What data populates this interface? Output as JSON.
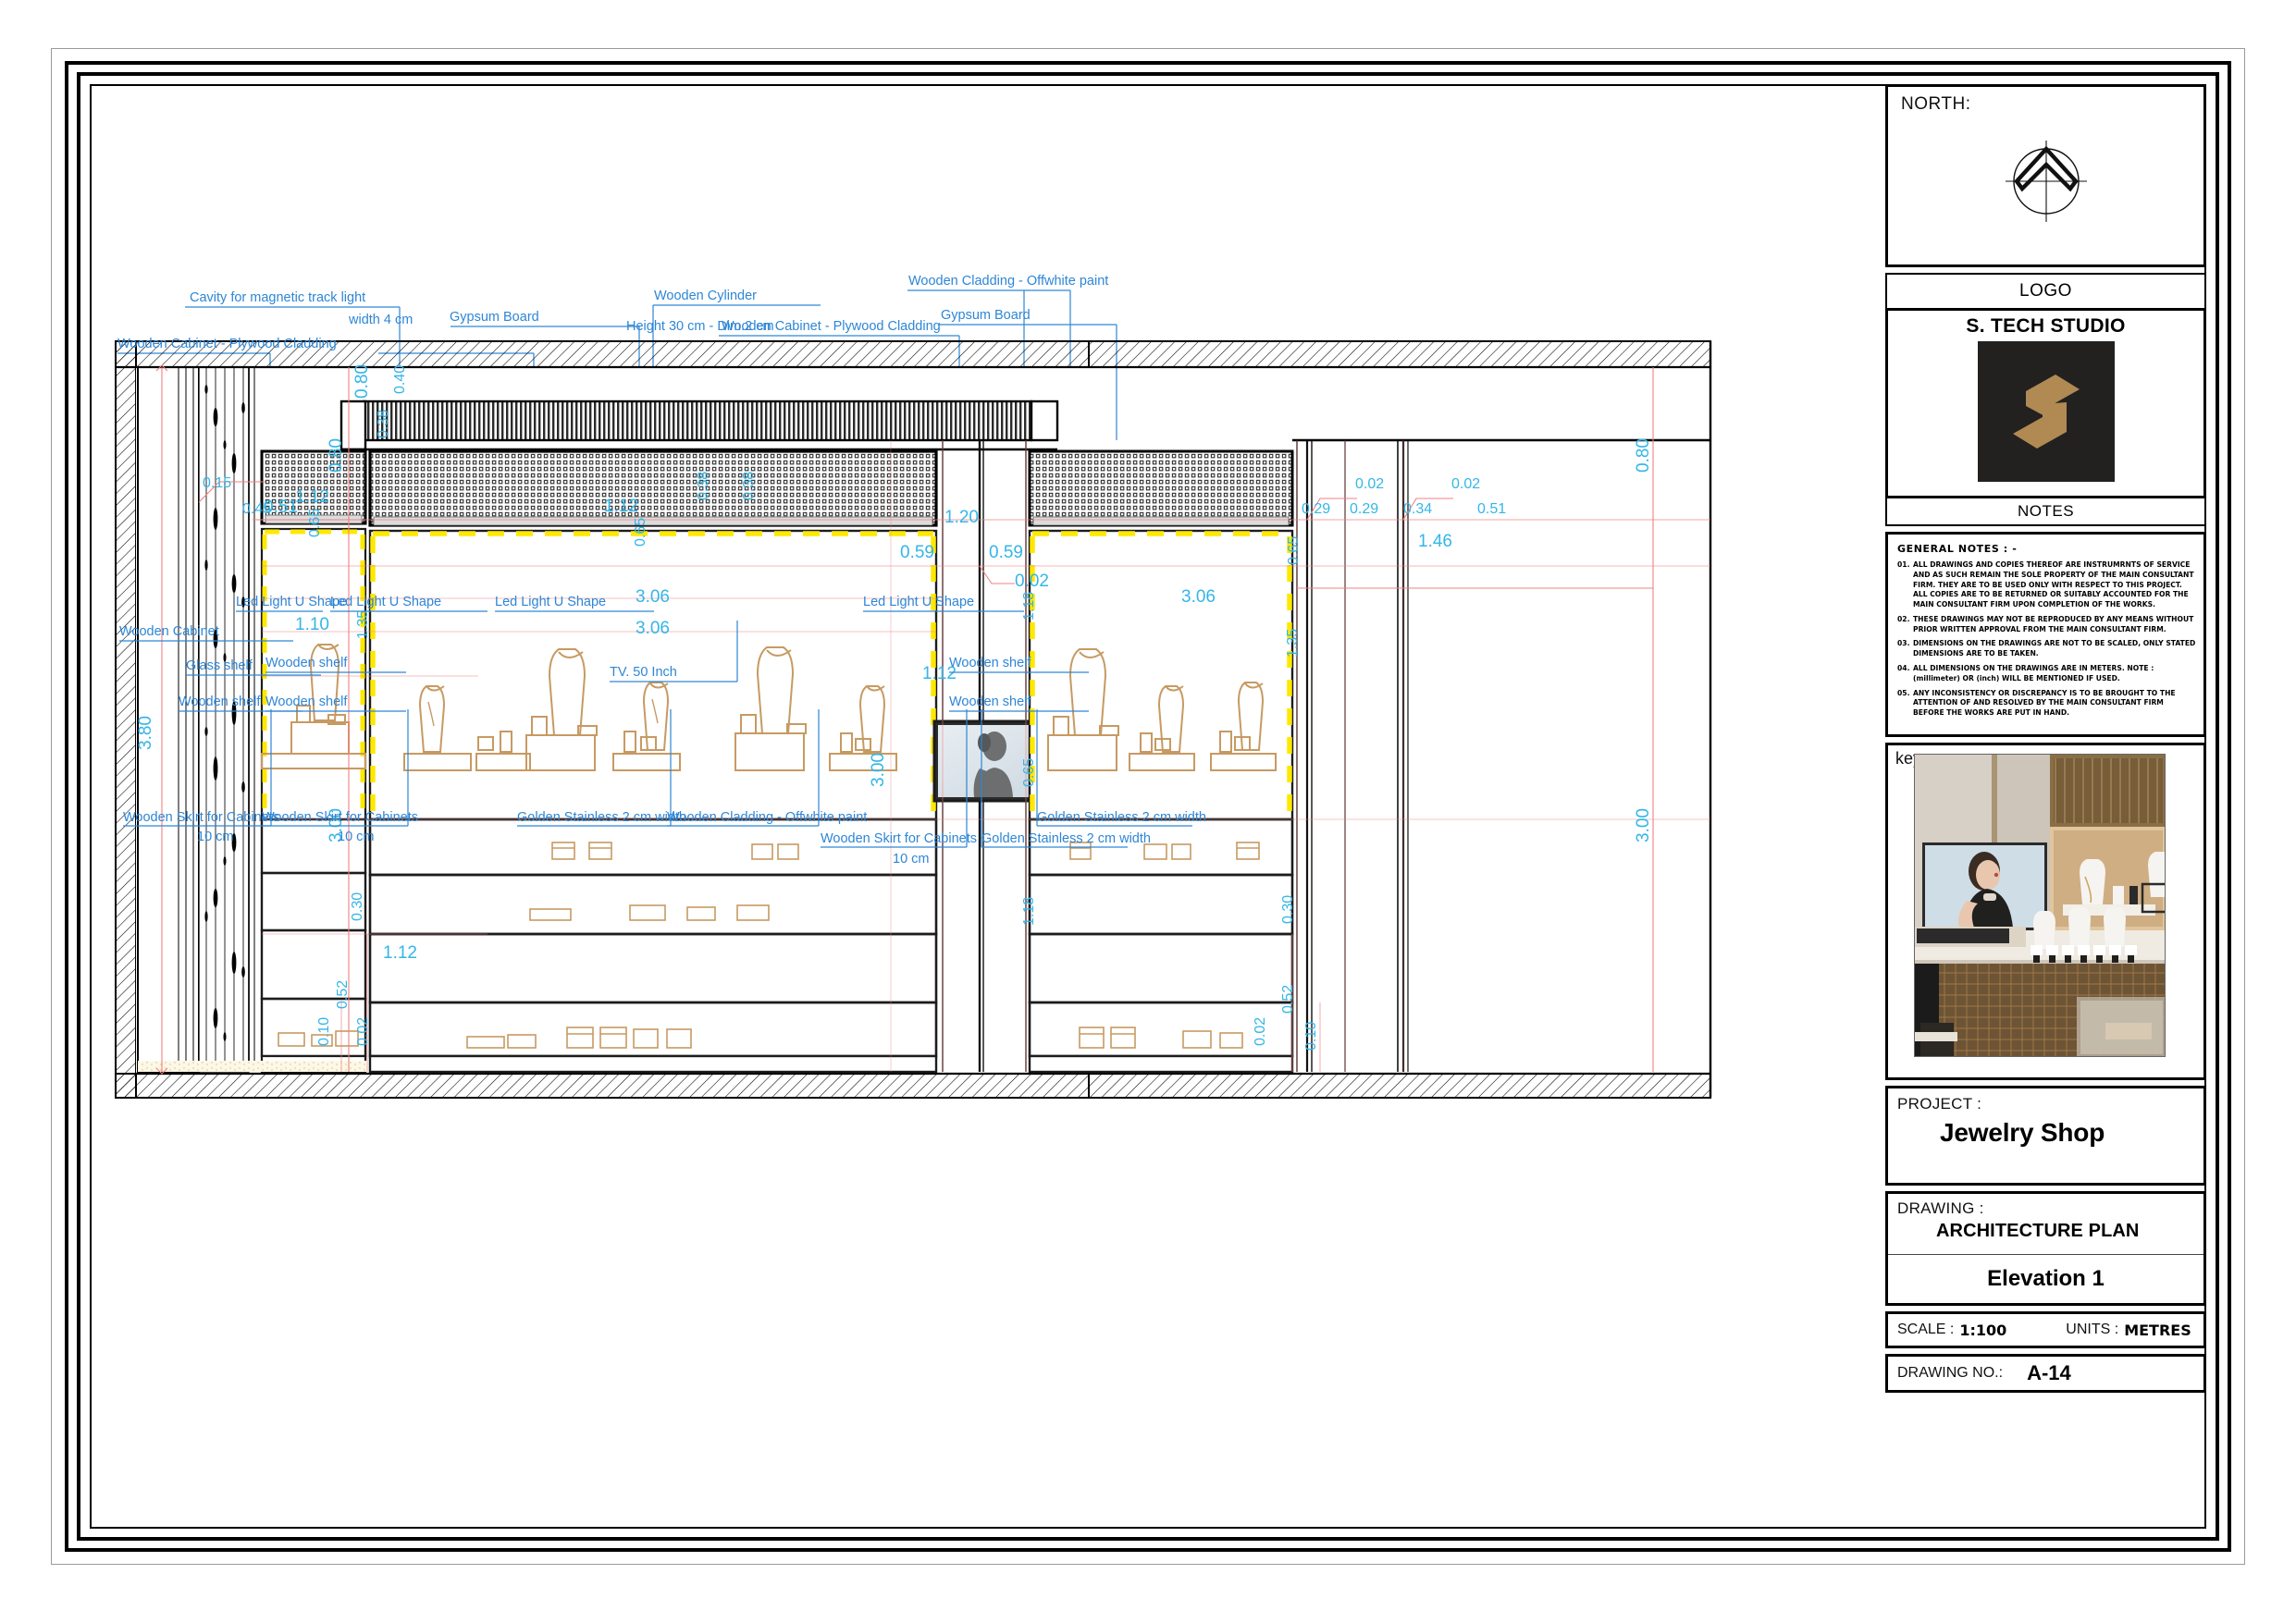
{
  "titleblock": {
    "north_label": "NORTH:",
    "logo_header": "LOGO",
    "studio_name": "S. TECH STUDIO",
    "notes_header": "NOTES",
    "general_notes_title": "GENERAL NOTES : -",
    "general_notes": [
      {
        "num": "01.",
        "text": "ALL DRAWINGS AND COPIES THEREOF ARE INSTRUMRNTS OF SERVICE AND AS SUCH REMAIN THE SOLE PROPERTY OF THE MAIN CONSULTANT FIRM. THEY ARE TO BE USED ONLY WITH RESPECT TO THIS PROJECT. ALL COPIES ARE TO BE RETURNED OR SUITABLY ACCOUNTED FOR THE MAIN CONSULTANT FIRM UPON COMPLETION OF THE WORKS."
      },
      {
        "num": "02.",
        "text": "THESE DRAWINGS MAY NOT BE REPRODUCED BY ANY MEANS WITHOUT PRIOR WRITTEN APPROVAL FROM THE MAIN CONSULTANT FIRM."
      },
      {
        "num": "03.",
        "text": "DIMENSIONS ON THE DRAWINGS ARE NOT TO BE SCALED, ONLY STATED DIMENSIONS ARE TO BE TAKEN."
      },
      {
        "num": "04.",
        "text": "ALL DIMENSIONS ON THE DRAWINGS ARE IN METERS. NOTE : (millimeter) OR (inch) WILL BE MENTIONED IF USED."
      },
      {
        "num": "05.",
        "text": "ANY INCONSISTENCY OR DISCREPANCY IS TO BE BROUGHT TO THE ATTENTION OF AND RESOLVED BY THE MAIN CONSULTANT FIRM BEFORE THE WORKS ARE PUT IN HAND."
      }
    ],
    "key_label": "key",
    "project_label": "PROJECT :",
    "project_name": "Jewelry Shop",
    "drawing_label": "DRAWING :",
    "drawing_type": "ARCHITECTURE PLAN",
    "drawing_name": "Elevation 1",
    "scale_label": "SCALE :",
    "scale_value": "1:100",
    "units_label": "UNITS :",
    "units_value": "METRES",
    "drawing_no_label": "DRAWING NO.:",
    "drawing_no_value": "A-14"
  },
  "colors": {
    "annotation_blue": "#2E86D6",
    "dimension_cyan": "#34B6E8",
    "dimension_line_red": "#F08080",
    "logo_gold": "#B08A52",
    "logo_bg": "#222120",
    "led_yellow": "#FFE800",
    "furniture_tan": "#C79A62"
  },
  "annotations": {
    "top": [
      {
        "id": "wooden-cabinet-plywood-cladding-left",
        "text": "Wooden Cabinet - Plywood Cladding"
      },
      {
        "id": "cavity-magnetic-track-light",
        "text": "Cavity for magnetic track light"
      },
      {
        "id": "cavity-magnetic-track-light-width",
        "text": "width 4 cm"
      },
      {
        "id": "gypsum-board-left",
        "text": "Gypsum Board"
      },
      {
        "id": "wooden-cylinder",
        "text": "Wooden Cylinder"
      },
      {
        "id": "wooden-cylinder-dims",
        "text": "Height 30 cm - Dim.2 cm"
      },
      {
        "id": "wooden-cabinet-plywood-cladding-right",
        "text": "Wooden Cabinet - Plywood Cladding"
      },
      {
        "id": "wooden-cladding-offwhite-paint-top",
        "text": "Wooden Cladding - Offwhite paint"
      },
      {
        "id": "gypsum-board-right",
        "text": "Gypsum Board"
      }
    ],
    "interior": [
      {
        "id": "led-light-u-shape-1",
        "text": "Led Light U Shape"
      },
      {
        "id": "led-light-u-shape-2",
        "text": "Led Light U Shape"
      },
      {
        "id": "led-light-u-shape-3",
        "text": "Led Light U Shape"
      },
      {
        "id": "led-light-u-shape-4",
        "text": "Led Light U Shape"
      },
      {
        "id": "wooden-cabinet-left",
        "text": "Wooden Cabinet"
      },
      {
        "id": "glass-shelf-left",
        "text": "Glass shelf"
      },
      {
        "id": "wooden-shelf-left-a",
        "text": "Wooden shelf"
      },
      {
        "id": "wooden-shelf-left-b",
        "text": "Wooden shelf"
      },
      {
        "id": "wooden-shelf-left-c",
        "text": "Wooden shelf"
      },
      {
        "id": "wooden-shelf-right-a",
        "text": "Wooden shelf"
      },
      {
        "id": "wooden-shelf-right-b",
        "text": "Wooden shelf"
      },
      {
        "id": "tv-50-inch",
        "text": "TV. 50 Inch"
      }
    ],
    "bottom": [
      {
        "id": "wooden-skirt-cabinets-1",
        "text": "Wooden Skirt for Cabinets",
        "sub": "10 cm"
      },
      {
        "id": "wooden-skirt-cabinets-2",
        "text": "Wooden Skirt for Cabinets",
        "sub": "10 cm"
      },
      {
        "id": "golden-stainless-1",
        "text": "Golden Stainless 2 cm width"
      },
      {
        "id": "wooden-cladding-offwhite-paint-bottom",
        "text": "Wooden Cladding - Offwhite paint"
      },
      {
        "id": "wooden-skirt-cabinets-3",
        "text": "Wooden Skirt for Cabinets",
        "sub": "10 cm"
      },
      {
        "id": "golden-stainless-2",
        "text": "Golden Stainless 2 cm width"
      },
      {
        "id": "golden-stainless-3",
        "text": "Golden Stainless 2 cm width"
      }
    ]
  },
  "dimensions": {
    "overall_height": "3.80",
    "left": [
      "0.80",
      "0.51",
      "3.00",
      "0.15",
      "0.45",
      "1.12",
      "0.65",
      "1.10",
      "1.35",
      "0.30",
      "0.52",
      "0.10",
      "0.02",
      "1.12"
    ],
    "center_top": [
      "0.80",
      "0.40",
      "0.38",
      "3.06",
      "3.06",
      "0.65"
    ],
    "center": [
      "1.20",
      "0.59",
      "0.59",
      "0.02",
      "1.18",
      "1.12",
      "3.00",
      "0.65",
      "1.18"
    ],
    "right": [
      "0.80",
      "0.02",
      "0.02",
      "0.29",
      "0.29",
      "0.34",
      "0.51",
      "1.46",
      "0.65",
      "1.35",
      "0.30",
      "0.52",
      "0.10",
      "0.02",
      "3.00"
    ],
    "values_all": [
      "3.80",
      "0.80",
      "0.51",
      "3.00",
      "0.15",
      "0.45",
      "0.40",
      "0.38",
      "1.12",
      "0.65",
      "1.10",
      "1.35",
      "3.06",
      "1.20",
      "0.59",
      "0.02",
      "1.18",
      "0.29",
      "0.34",
      "1.46",
      "0.30",
      "0.52",
      "0.10"
    ]
  }
}
